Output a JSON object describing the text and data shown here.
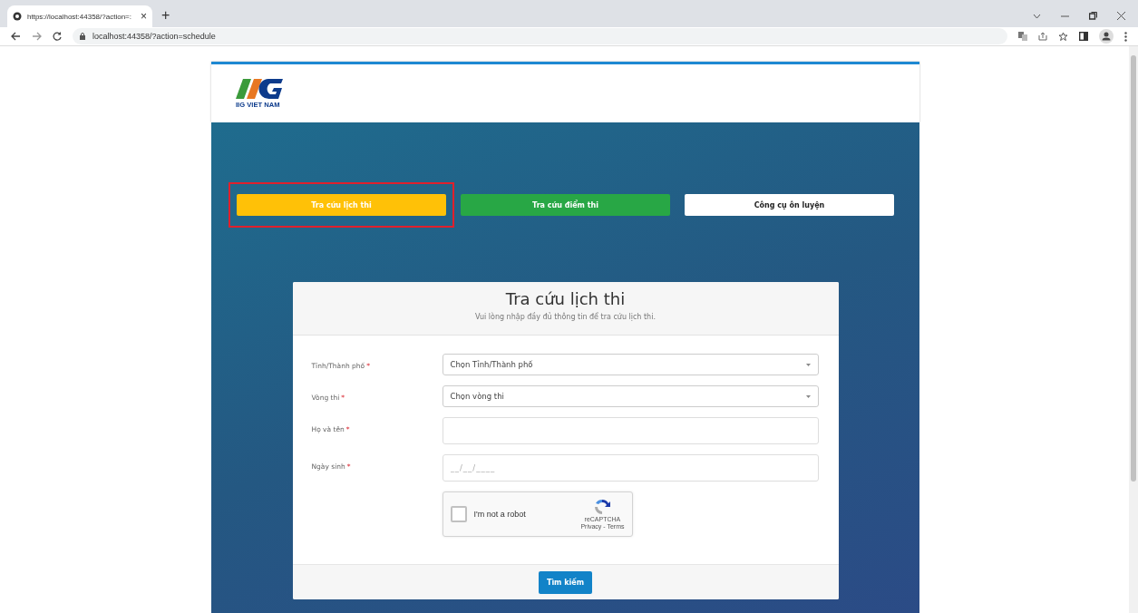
{
  "browser": {
    "tab_title": "https://localhost:44358/?action=:",
    "tab_close": "×",
    "new_tab": "+",
    "address": "localhost:44358/?action=schedule"
  },
  "logo": {
    "caption": "IIG VIET NAM"
  },
  "nav_buttons": [
    {
      "label": "Tra cứu lịch thi",
      "color": "#ffc107",
      "highlighted": true
    },
    {
      "label": "Tra cứu điểm thi",
      "color": "#28a745",
      "highlighted": false
    },
    {
      "label": "Công cụ ôn luyện",
      "color": "#ffffff",
      "highlighted": false
    }
  ],
  "form": {
    "title": "Tra cứu lịch thi",
    "subtitle": "Vui lòng nhập đầy đủ thông tin để tra cứu lịch thi.",
    "fields": [
      {
        "kind": "select",
        "label": "Tỉnh/Thành phố",
        "required": "*",
        "placeholder": "Chọn Tỉnh/Thành phố"
      },
      {
        "kind": "select",
        "label": "Vòng thi",
        "required": "*",
        "placeholder": "Chọn vòng thi"
      },
      {
        "kind": "text",
        "label": "Họ và tên",
        "required": "*"
      },
      {
        "kind": "text",
        "label": "Ngày sinh",
        "required": "*",
        "placeholder": "__/__/____"
      }
    ],
    "captcha": {
      "label": "I'm not a robot",
      "checked": false,
      "brand": "reCAPTCHA",
      "links": "Privacy - Terms"
    },
    "submit": "Tìm kiếm"
  }
}
